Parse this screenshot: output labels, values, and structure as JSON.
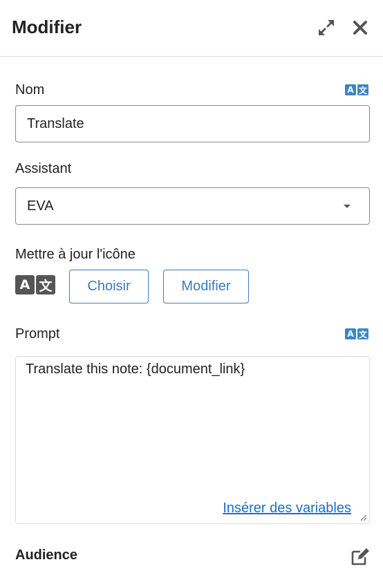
{
  "header": {
    "title": "Modifier",
    "expand_icon": "expand-arrows-icon",
    "close_icon": "close-icon"
  },
  "name_field": {
    "label": "Nom",
    "value": "Translate",
    "translate_icon": "translate-icon"
  },
  "assistant_field": {
    "label": "Assistant",
    "selected": "EVA"
  },
  "icon_field": {
    "label": "Mettre à jour l'icône",
    "preview_icon": "translate-icon",
    "preview_glyph_a": "A",
    "preview_glyph_b": "文",
    "choose_label": "Choisir",
    "modify_label": "Modifier"
  },
  "prompt_field": {
    "label": "Prompt",
    "value": "Translate this note: {document_link}",
    "insert_variables_label": "Insérer des variables",
    "translate_icon": "translate-icon"
  },
  "audience": {
    "label": "Audience",
    "edit_icon": "edit-icon"
  },
  "colors": {
    "accent": "#3d7ab8",
    "link": "#1a6fc4",
    "translate_badge": "#3c86c4",
    "icon_preview": "#555555"
  }
}
